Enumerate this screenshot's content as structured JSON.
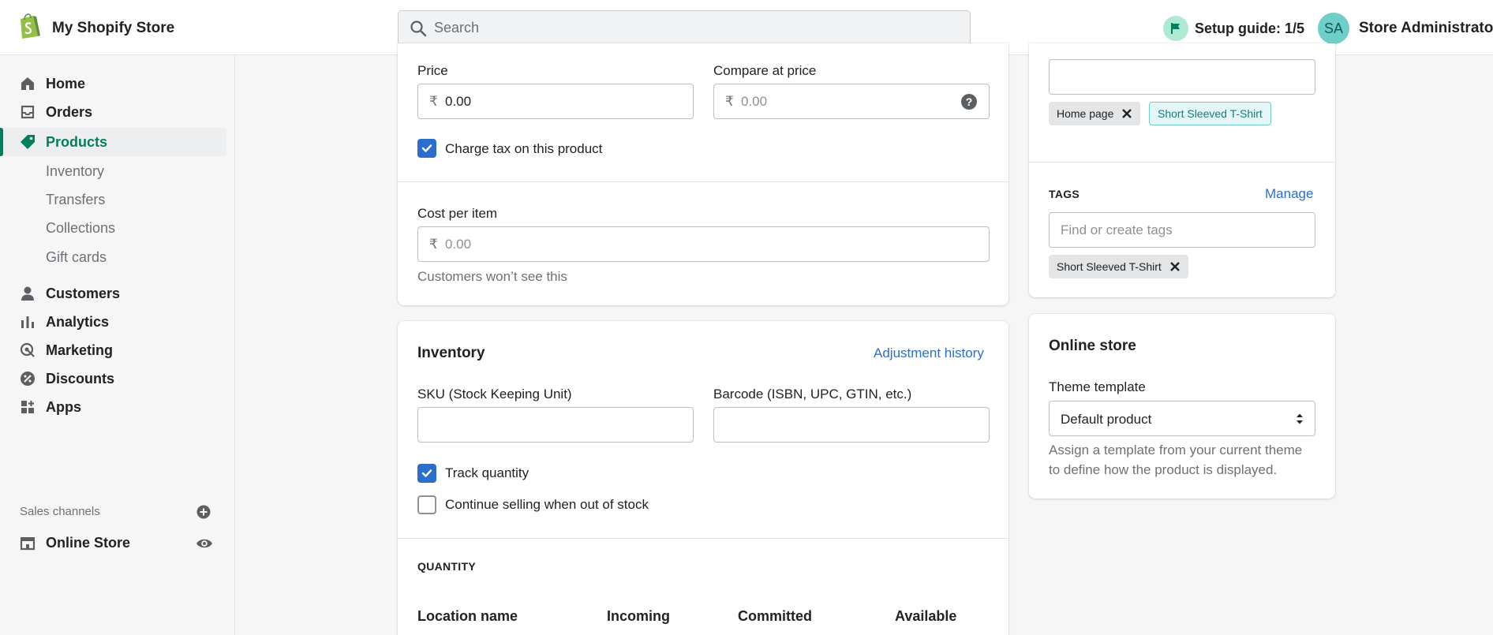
{
  "header": {
    "store_name": "My Shopify Store",
    "search_placeholder": "Search",
    "setup_guide": "Setup guide: 1/5",
    "user_initials": "SA",
    "user_name": "Store Administrator"
  },
  "sidebar": {
    "items": [
      {
        "label": "Home",
        "icon": "home-icon"
      },
      {
        "label": "Orders",
        "icon": "orders-icon"
      },
      {
        "label": "Products",
        "icon": "tag-icon",
        "active": true
      },
      {
        "label": "Customers",
        "icon": "person-icon"
      },
      {
        "label": "Analytics",
        "icon": "bar-chart-icon"
      },
      {
        "label": "Marketing",
        "icon": "marketing-icon"
      },
      {
        "label": "Discounts",
        "icon": "discount-icon"
      },
      {
        "label": "Apps",
        "icon": "apps-icon"
      }
    ],
    "product_subitems": [
      "Inventory",
      "Transfers",
      "Collections",
      "Gift cards"
    ],
    "sales_channels_title": "Sales channels",
    "online_store": "Online Store"
  },
  "pricing": {
    "price_label": "Price",
    "price_value": "0.00",
    "currency": "₹",
    "compare_label": "Compare at price",
    "compare_placeholder": "0.00",
    "charge_tax_label": "Charge tax on this product",
    "charge_tax_checked": true,
    "cost_label": "Cost per item",
    "cost_placeholder": "0.00",
    "cost_help": "Customers won’t see this"
  },
  "inventory": {
    "title": "Inventory",
    "adjustment_link": "Adjustment history",
    "sku_label": "SKU (Stock Keeping Unit)",
    "sku_value": "",
    "barcode_label": "Barcode (ISBN, UPC, GTIN, etc.)",
    "barcode_value": "",
    "track_label": "Track quantity",
    "track_checked": true,
    "continue_label": "Continue selling when out of stock",
    "continue_checked": false,
    "quantity_title": "QUANTITY",
    "columns": [
      "Location name",
      "Incoming",
      "Committed",
      "Available"
    ]
  },
  "organization": {
    "collections_value": "",
    "collection_tags": [
      "Home page",
      "Short Sleeved T-Shirt"
    ],
    "tags_title": "TAGS",
    "manage_link": "Manage",
    "tags_placeholder": "Find or create tags",
    "tags": [
      "Short Sleeved T-Shirt"
    ]
  },
  "online_store": {
    "title": "Online store",
    "theme_label": "Theme template",
    "theme_value": "Default product",
    "theme_help_line1": "Assign a template from your current theme",
    "theme_help_line2": "to define how the product is displayed."
  },
  "colors": {
    "accent_green": "#008060",
    "link_blue": "#2c6ecb",
    "checkbox_blue": "#2c6ecb"
  }
}
